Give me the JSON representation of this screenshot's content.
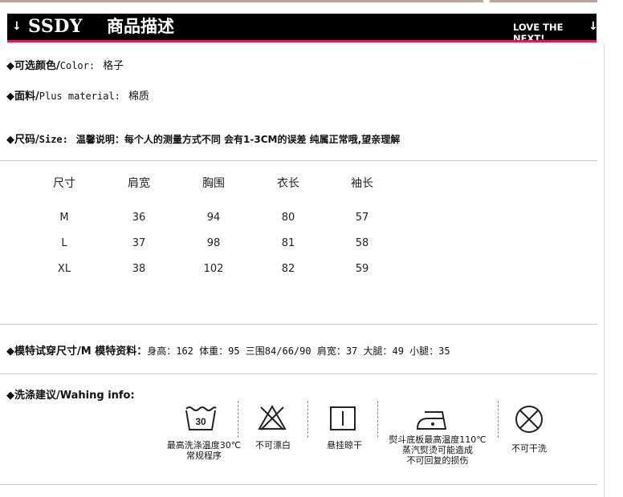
{
  "header": {
    "brand": "SSDY",
    "title": "商品描述",
    "right_text": "LOVE THE NEXT!",
    "arrow": "↓",
    "bar_color": "#000000",
    "accent_color": "#e4175a"
  },
  "bullet": "◆",
  "color_line": {
    "label_cn": "可选颜色/",
    "label_en": "Color:",
    "value": "格子"
  },
  "material_line": {
    "label_cn": "面料/",
    "label_en": "Plus material:",
    "value": "棉质"
  },
  "size_line": {
    "label_cn": "尺码/",
    "label_en": "Size:",
    "note": "温馨说明：每个人的测量方式不同 会有1-3CM的误差 纯属正常哦,望亲理解"
  },
  "size_table": {
    "headers": [
      "尺寸",
      "肩宽",
      "胸围",
      "衣长",
      "袖长"
    ],
    "rows": [
      [
        "M",
        "36",
        "94",
        "80",
        "57"
      ],
      [
        "L",
        "37",
        "98",
        "81",
        "58"
      ],
      [
        "XL",
        "38",
        "102",
        "82",
        "59"
      ]
    ]
  },
  "model_line": {
    "label": "模特试穿尺寸/M 模特资料：",
    "value": "身高：162 体重：95 三围84/66/90 肩宽：37 大腿：49 小腿：35"
  },
  "washing_line": {
    "label": "洗涤建议/Wahing info:"
  },
  "care": {
    "wash_temp": "30",
    "items": [
      {
        "icon": "wash-30-icon",
        "label_lines": [
          "最高洗涤温度30℃",
          "常规程序"
        ]
      },
      {
        "icon": "no-bleach-icon",
        "label_lines": [
          "不可漂白"
        ]
      },
      {
        "icon": "line-dry-icon",
        "label_lines": [
          "悬挂晾干"
        ]
      },
      {
        "icon": "iron-icon",
        "label_lines": [
          "熨斗底板最高温度110℃",
          "蒸汽熨烫可能造成",
          "不可回复的损伤"
        ]
      },
      {
        "icon": "no-dry-clean-icon",
        "label_lines": [
          "不可干洗"
        ]
      }
    ]
  }
}
